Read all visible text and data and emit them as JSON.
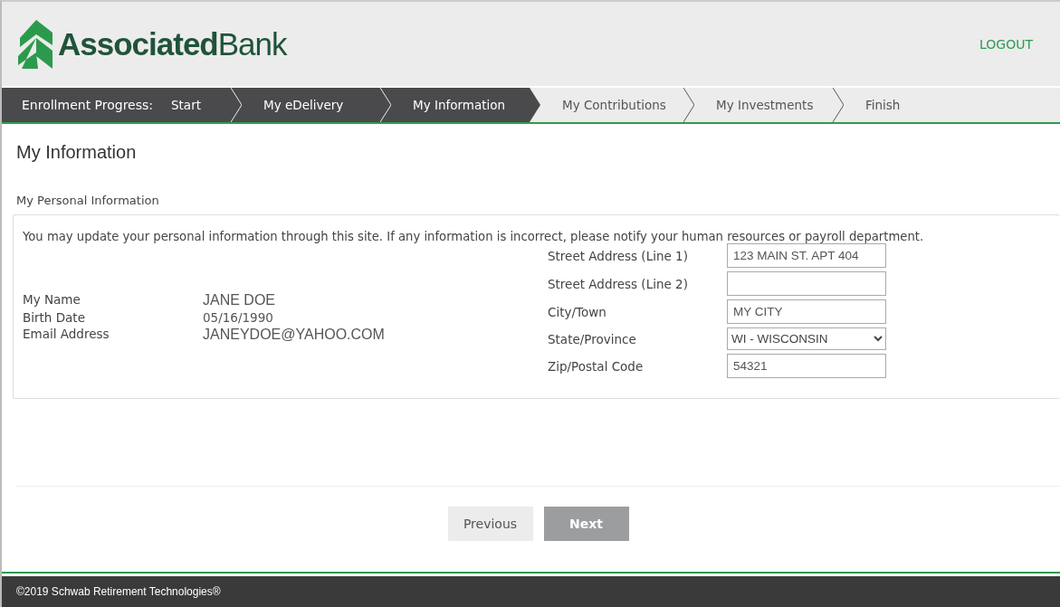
{
  "brand": {
    "name_bold": "Associated",
    "name_light": "Bank"
  },
  "logout": "LOGOUT",
  "progress": {
    "label": "Enrollment Progress:",
    "steps": [
      {
        "label": "Start",
        "reached": true
      },
      {
        "label": "My eDelivery",
        "reached": true
      },
      {
        "label": "My Information",
        "reached": true
      },
      {
        "label": "My Contributions",
        "reached": false
      },
      {
        "label": "My Investments",
        "reached": false
      },
      {
        "label": "Finish",
        "reached": false
      }
    ]
  },
  "page_title": "My Information",
  "section_title": "My Personal Information",
  "intro": "You may update your personal information through this site. If any information is incorrect, please notify your human resources or payroll department.",
  "personal": [
    {
      "label": "My Name",
      "value": "JANE DOE",
      "kind": "caps"
    },
    {
      "label": "Birth Date",
      "value": "05/16/1990",
      "kind": "plain"
    },
    {
      "label": "Email Address",
      "value": "JANEYDOE@YAHOO.COM",
      "kind": "caps"
    }
  ],
  "address": [
    {
      "label": "Street Address (Line 1)",
      "value": "123 MAIN ST. APT 404",
      "kind": "text"
    },
    {
      "label": "Street Address (Line 2)",
      "kind": "text"
    },
    {
      "label": "City/Town",
      "value": "MY CITY",
      "kind": "text"
    },
    {
      "label": "State/Province",
      "value": "WI - WISCONSIN",
      "kind": "select"
    },
    {
      "label": "Zip/Postal Code",
      "value": "54321",
      "kind": "text"
    }
  ],
  "buttons": [
    {
      "label": "Previous",
      "disabled": false
    },
    {
      "label": "Next",
      "disabled": true
    }
  ],
  "footer": "©2019 Schwab Retirement Technologies®"
}
